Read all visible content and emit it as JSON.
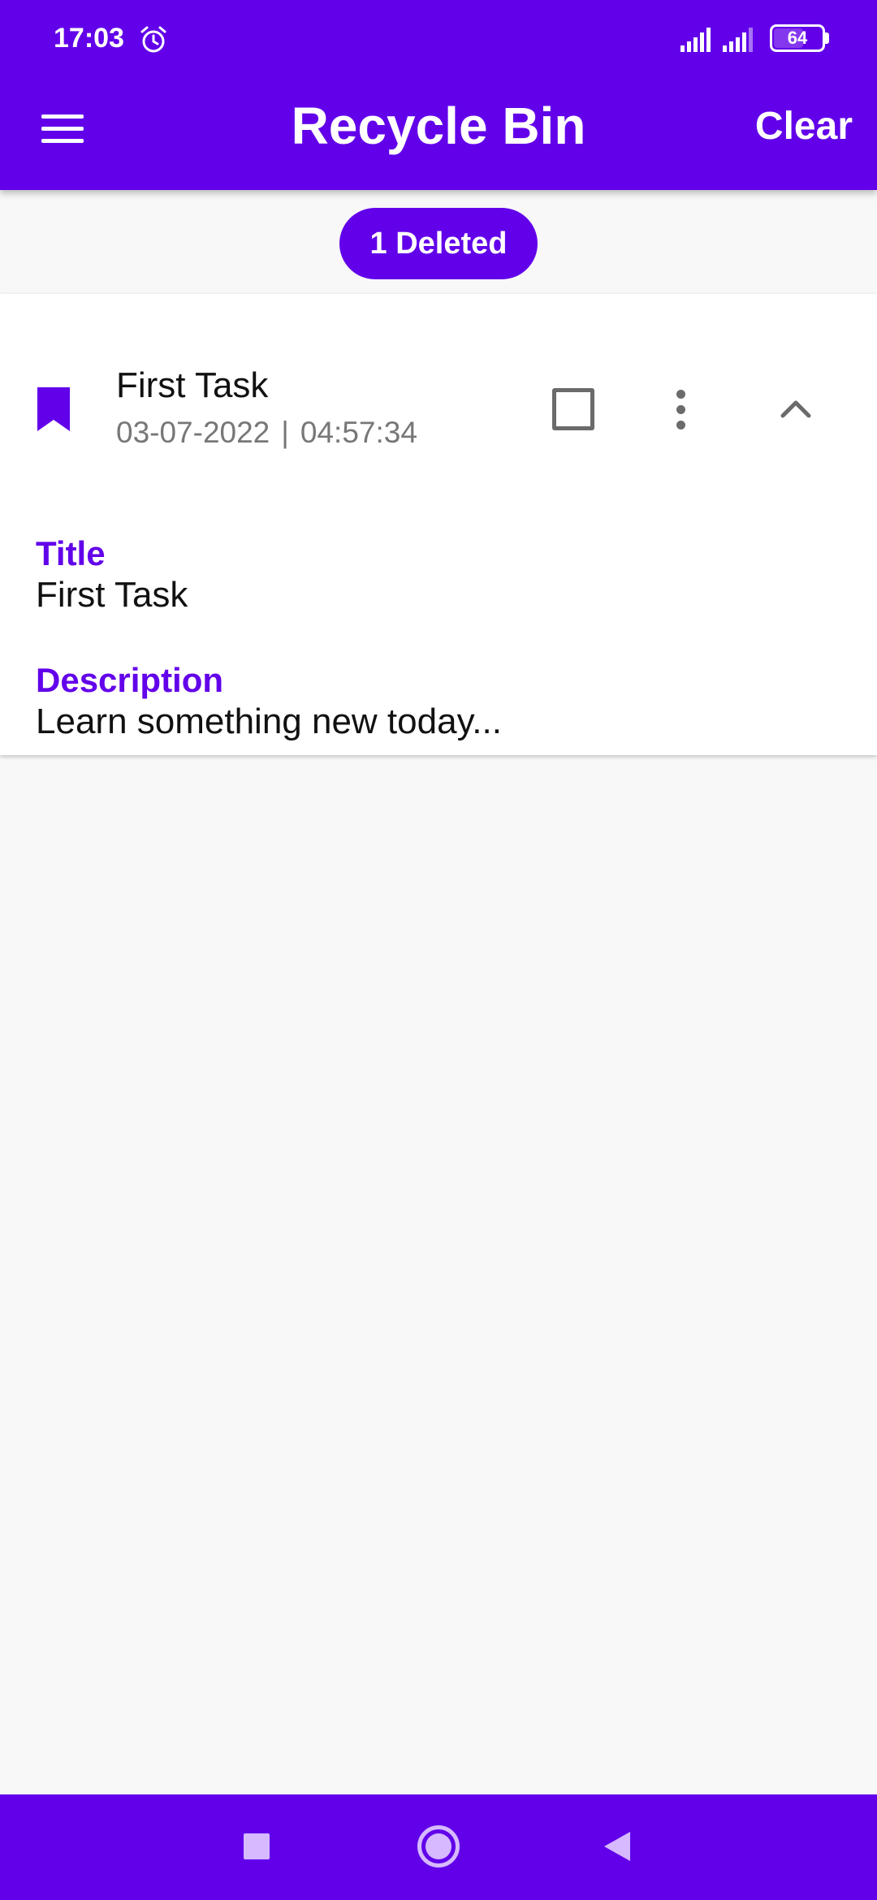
{
  "status_bar": {
    "time": "17:03",
    "alarm_icon": "alarm-clock-icon",
    "signal_icons": [
      "signal-bars-icon",
      "signal-bars-icon"
    ],
    "battery_level": "64"
  },
  "app_bar": {
    "menu_icon": "hamburger-menu-icon",
    "title": "Recycle Bin",
    "action_label": "Clear"
  },
  "deleted_chip": {
    "label": "1 Deleted"
  },
  "task_card": {
    "icon": "bookmark-icon",
    "title": "First Task",
    "date": "03-07-2022",
    "separator": "|",
    "time": "04:57:34",
    "checked": false,
    "more_icon": "more-vertical-icon",
    "expand_icon": "chevron-up-icon",
    "details": {
      "title_label": "Title",
      "title_value": "First Task",
      "description_label": "Description",
      "description_value": "Learn something new today..."
    }
  },
  "nav_bar": {
    "recents_icon": "square-recents-icon",
    "home_icon": "circle-home-icon",
    "back_icon": "triangle-back-icon"
  },
  "colors": {
    "primary": "#6200ea",
    "on_primary": "#ffffff",
    "background": "#f8f8f8",
    "card": "#ffffff",
    "secondary_text": "#777777",
    "nav_icon": "#d6b9ff"
  }
}
